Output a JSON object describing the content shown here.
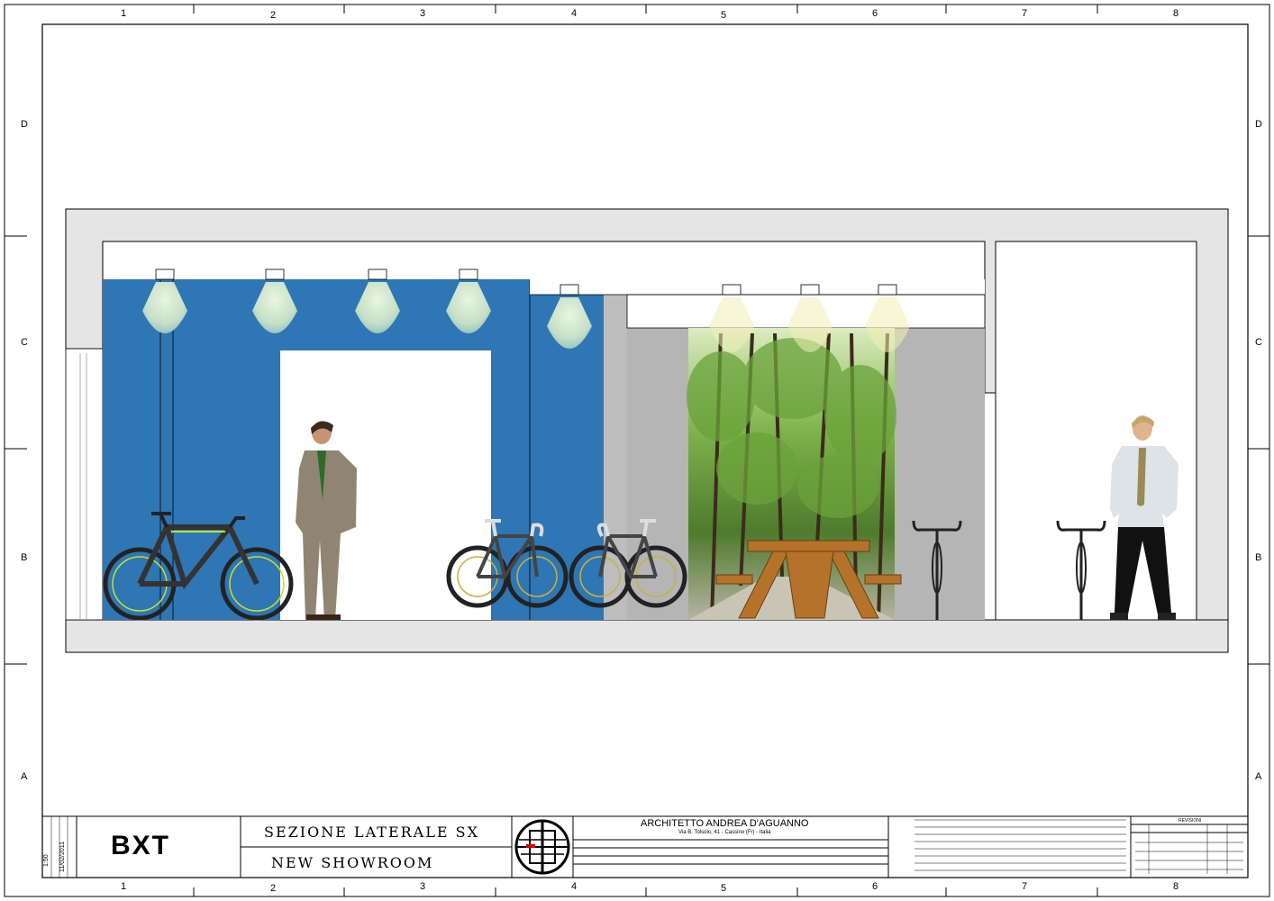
{
  "grid": {
    "columns": [
      "1",
      "2",
      "3",
      "4",
      "5",
      "6",
      "7",
      "8"
    ],
    "rows": [
      "D",
      "C",
      "B",
      "A"
    ]
  },
  "title_block": {
    "client": "BXT",
    "drawing_title": "SEZIONE LATERALE SX",
    "project": "NEW SHOWROOM",
    "architect": "ARCHITETTO ANDREA D'AGUANNO",
    "address": "Via B. Tolsoio, 41 - Cassino (Fr) - Italia",
    "revisions_label": "REVISIONI",
    "scale": "1:50",
    "date": "11/02/2011"
  },
  "colors": {
    "wall_blue": "#2e76b4",
    "wall_grey": "#b9b9b9",
    "structure_grey": "#e5e5e5",
    "frame": "#000000"
  },
  "icons": [
    "spotlight-icon",
    "bicycle-icon",
    "person-figure",
    "forest-mural",
    "picnic-table",
    "architect-logo"
  ]
}
